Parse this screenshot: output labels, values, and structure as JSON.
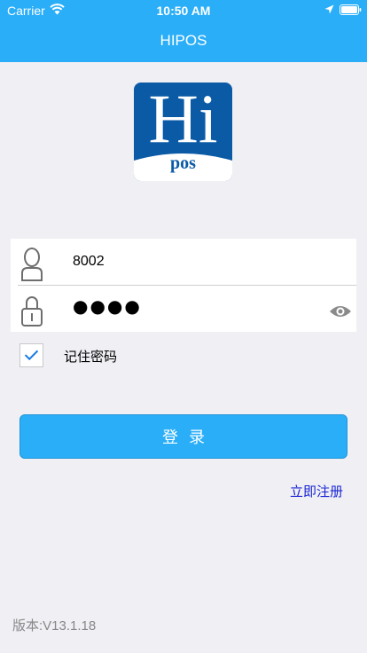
{
  "status_bar": {
    "carrier": "Carrier",
    "time": "10:50 AM",
    "icons": [
      "wifi-icon",
      "location-icon",
      "battery-icon"
    ]
  },
  "header": {
    "title": "HIPOS",
    "background": "#2aaef8"
  },
  "logo": {
    "text_main": "Hi",
    "text_sub": "pos",
    "background": "#0a5aa6"
  },
  "login_form": {
    "username": "8002",
    "password_masked": "●●●●",
    "icons": [
      "user-icon",
      "lock-icon",
      "eye-icon"
    ]
  },
  "remember": {
    "label": "记住密码",
    "checked": true
  },
  "actions": {
    "login_label": "登录",
    "register_label": "立即注册"
  },
  "footer": {
    "version": "版本:V13.1.18"
  },
  "colors": {
    "accent": "#2aaef8",
    "page_background": "#efeff4",
    "link": "#1a24d4"
  }
}
